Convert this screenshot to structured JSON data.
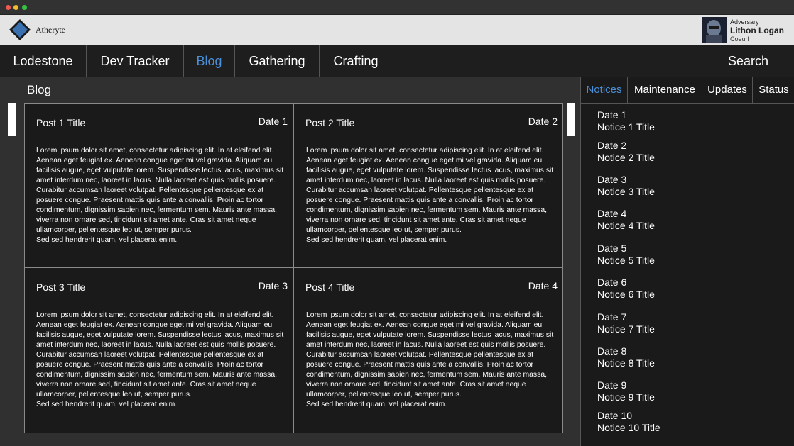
{
  "brand": {
    "name": "Atheryte",
    "logo_icon": "diamond-logo-icon",
    "accent_color": "#3a6fb0"
  },
  "user": {
    "role": "Adversary",
    "name": "Lithon Logan",
    "server": "Coeurl"
  },
  "nav": {
    "items": [
      "Lodestone",
      "Dev Tracker",
      "Blog",
      "Gathering",
      "Crafting"
    ],
    "active": "Blog",
    "search_label": "Search",
    "active_color": "#4a8fd8"
  },
  "blog": {
    "heading": "Blog",
    "posts": [
      {
        "title": "Post 1 Title",
        "date": "Date 1",
        "body": "Lorem ipsum dolor sit amet, consectetur adipiscing elit. In at eleifend elit. Aenean eget feugiat ex. Aenean congue eget mi vel gravida. Aliquam eu facilisis augue, eget vulputate lorem. Suspendisse lectus lacus, maximus sit amet interdum nec, laoreet in lacus. Nulla laoreet est quis mollis posuere. Curabitur accumsan laoreet volutpat. Pellentesque pellentesque ex at posuere congue. Praesent mattis quis ante a convallis. Proin ac tortor condimentum, dignissim sapien nec, fermentum sem. Mauris ante massa, viverra non ornare sed, tincidunt sit amet ante. Cras sit amet neque ullamcorper, pellentesque leo ut, semper purus.\nSed sed hendrerit quam, vel placerat enim."
      },
      {
        "title": "Post 2 Title",
        "date": "Date 2",
        "body": "Lorem ipsum dolor sit amet, consectetur adipiscing elit. In at eleifend elit. Aenean eget feugiat ex. Aenean congue eget mi vel gravida. Aliquam eu facilisis augue, eget vulputate lorem. Suspendisse lectus lacus, maximus sit amet interdum nec, laoreet in lacus. Nulla laoreet est quis mollis posuere. Curabitur accumsan laoreet volutpat. Pellentesque pellentesque ex at posuere congue. Praesent mattis quis ante a convallis. Proin ac tortor condimentum, dignissim sapien nec, fermentum sem. Mauris ante massa, viverra non ornare sed, tincidunt sit amet ante. Cras sit amet neque ullamcorper, pellentesque leo ut, semper purus.\nSed sed hendrerit quam, vel placerat enim."
      },
      {
        "title": "Post 3 Title",
        "date": "Date 3",
        "body": "Lorem ipsum dolor sit amet, consectetur adipiscing elit. In at eleifend elit. Aenean eget feugiat ex. Aenean congue eget mi vel gravida. Aliquam eu facilisis augue, eget vulputate lorem. Suspendisse lectus lacus, maximus sit amet interdum nec, laoreet in lacus. Nulla laoreet est quis mollis posuere. Curabitur accumsan laoreet volutpat. Pellentesque pellentesque ex at posuere congue. Praesent mattis quis ante a convallis. Proin ac tortor condimentum, dignissim sapien nec, fermentum sem. Mauris ante massa, viverra non ornare sed, tincidunt sit amet ante. Cras sit amet neque ullamcorper, pellentesque leo ut, semper purus.\nSed sed hendrerit quam, vel placerat enim."
      },
      {
        "title": "Post 4 Title",
        "date": "Date 4",
        "body": "Lorem ipsum dolor sit amet, consectetur adipiscing elit. In at eleifend elit. Aenean eget feugiat ex. Aenean congue eget mi vel gravida. Aliquam eu facilisis augue, eget vulputate lorem. Suspendisse lectus lacus, maximus sit amet interdum nec, laoreet in lacus. Nulla laoreet est quis mollis posuere. Curabitur accumsan laoreet volutpat. Pellentesque pellentesque ex at posuere congue. Praesent mattis quis ante a convallis. Proin ac tortor condimentum, dignissim sapien nec, fermentum sem. Mauris ante massa, viverra non ornare sed, tincidunt sit amet ante. Cras sit amet neque ullamcorper, pellentesque leo ut, semper purus.\nSed sed hendrerit quam, vel placerat enim."
      }
    ]
  },
  "sidebar": {
    "tabs": [
      "Notices",
      "Maintenance",
      "Updates",
      "Status"
    ],
    "active_tab": "Notices",
    "notices": [
      {
        "date": "Date 1",
        "title": "Notice 1 Title"
      },
      {
        "date": "Date 2",
        "title": "Notice 2 Title"
      },
      {
        "date": "Date 3",
        "title": "Notice 3 Title"
      },
      {
        "date": "Date 4",
        "title": "Notice 4 Title"
      },
      {
        "date": "Date 5",
        "title": "Notice 5 Title"
      },
      {
        "date": "Date 6",
        "title": "Notice 6 Title"
      },
      {
        "date": "Date 7",
        "title": "Notice 7 Title"
      },
      {
        "date": "Date 8",
        "title": "Notice 8 Title"
      },
      {
        "date": "Date 9",
        "title": "Notice 9 Title"
      },
      {
        "date": "Date 10",
        "title": "Notice 10 Title"
      }
    ]
  }
}
